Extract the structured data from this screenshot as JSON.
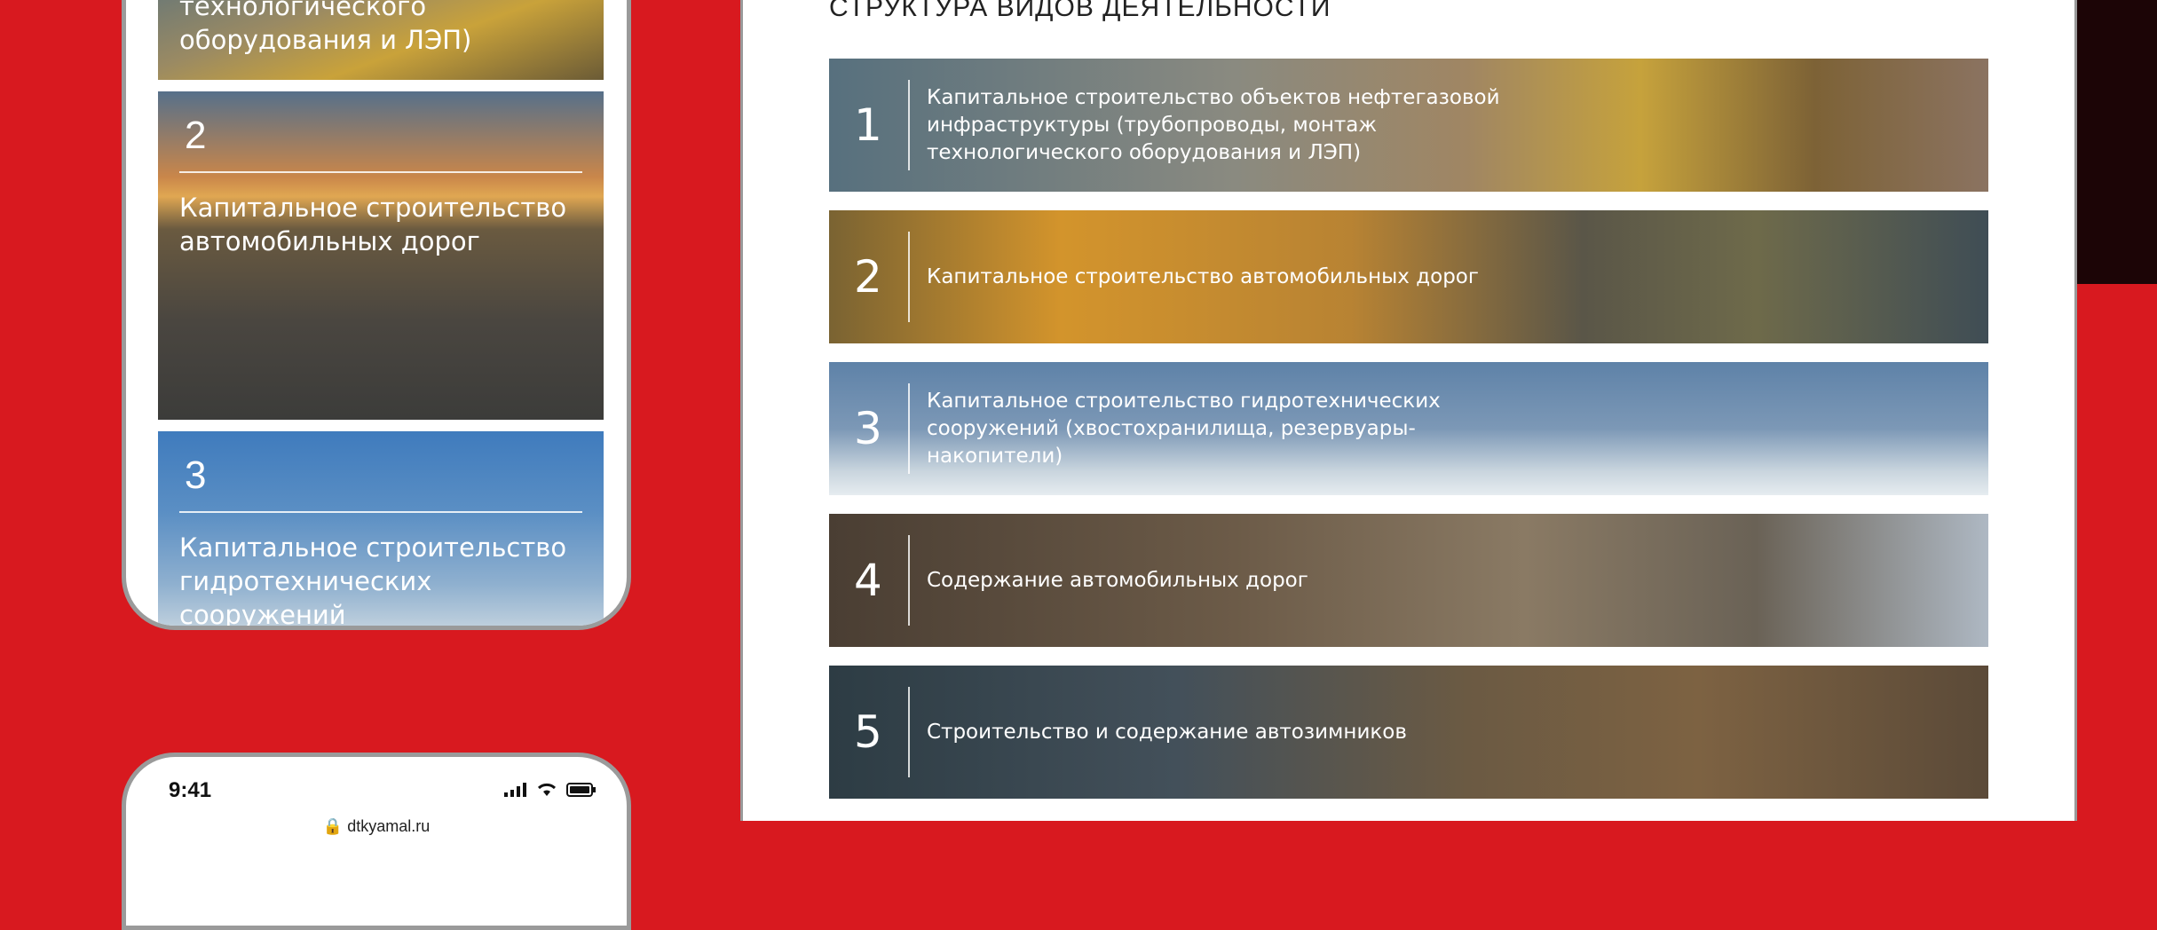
{
  "mobile_top": {
    "cards": [
      {
        "number": "",
        "text": "технологического\nоборудования и ЛЭП)"
      },
      {
        "number": "2",
        "text": "Капитальное строительство автомобильных дорог"
      },
      {
        "number": "3",
        "text": "Капитальное строительство гидротехнических сооружений (хвостохранилища, резервуары-"
      }
    ]
  },
  "mobile_bottom": {
    "time": "9:41",
    "url": "dtkyamal.ru"
  },
  "section": {
    "title": "СТРУКТУРА ВИДОВ ДЕЯТЕЛЬНОСТИ",
    "rows": [
      {
        "number": "1",
        "text": "Капитальное строительство объектов нефтегазовой инфраструктуры (трубопроводы, монтаж технологического оборудования и ЛЭП)"
      },
      {
        "number": "2",
        "text": "Капитальное строительство автомобильных дорог"
      },
      {
        "number": "3",
        "text": "Капитальное строительство гидротехнических сооружений (хвостохранилища, резервуары-накопители)"
      },
      {
        "number": "4",
        "text": "Содержание автомобильных дорог"
      },
      {
        "number": "5",
        "text": "Строительство и содержание автозимников"
      }
    ]
  },
  "colors": {
    "background": "#d8191f",
    "panel": "#ffffff",
    "frame": "#9a9a9a"
  }
}
